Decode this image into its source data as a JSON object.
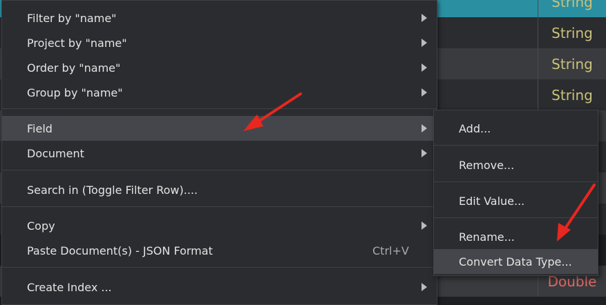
{
  "background_rows": [
    {
      "type": "String"
    },
    {
      "type": "String"
    },
    {
      "type": "String"
    },
    {
      "type": "String"
    },
    {
      "type": ""
    },
    {
      "type": ""
    },
    {
      "type": ""
    },
    {
      "type": ""
    },
    {
      "type": "Double"
    }
  ],
  "context_menu": {
    "items": [
      {
        "label": "Filter by \"name\"",
        "submenu": true
      },
      {
        "label": "Project by \"name\"",
        "submenu": true
      },
      {
        "label": "Order by \"name\"",
        "submenu": true
      },
      {
        "label": "Group by \"name\"",
        "submenu": true
      },
      {
        "label": "Field",
        "submenu": true,
        "highlighted": true
      },
      {
        "label": "Document",
        "submenu": true
      },
      {
        "label": "Search in (Toggle Filter Row)....",
        "submenu": false
      },
      {
        "label": "Copy",
        "submenu": true
      },
      {
        "label": "Paste Document(s) - JSON Format",
        "submenu": false,
        "shortcut": "Ctrl+V"
      },
      {
        "label": "Create Index ...",
        "submenu": true
      }
    ]
  },
  "field_submenu": {
    "items": [
      {
        "label": "Add..."
      },
      {
        "label": "Remove..."
      },
      {
        "label": "Edit Value..."
      },
      {
        "label": "Rename..."
      },
      {
        "label": "Convert Data Type...",
        "highlighted": true
      }
    ]
  },
  "colors": {
    "menu_bg": "#2b2c30",
    "highlight": "#45464b",
    "string_type": "#c9c27a",
    "double_type": "#e26a67",
    "selected_row": "#2b8fa2",
    "annotation_arrow": "#e8271f"
  }
}
